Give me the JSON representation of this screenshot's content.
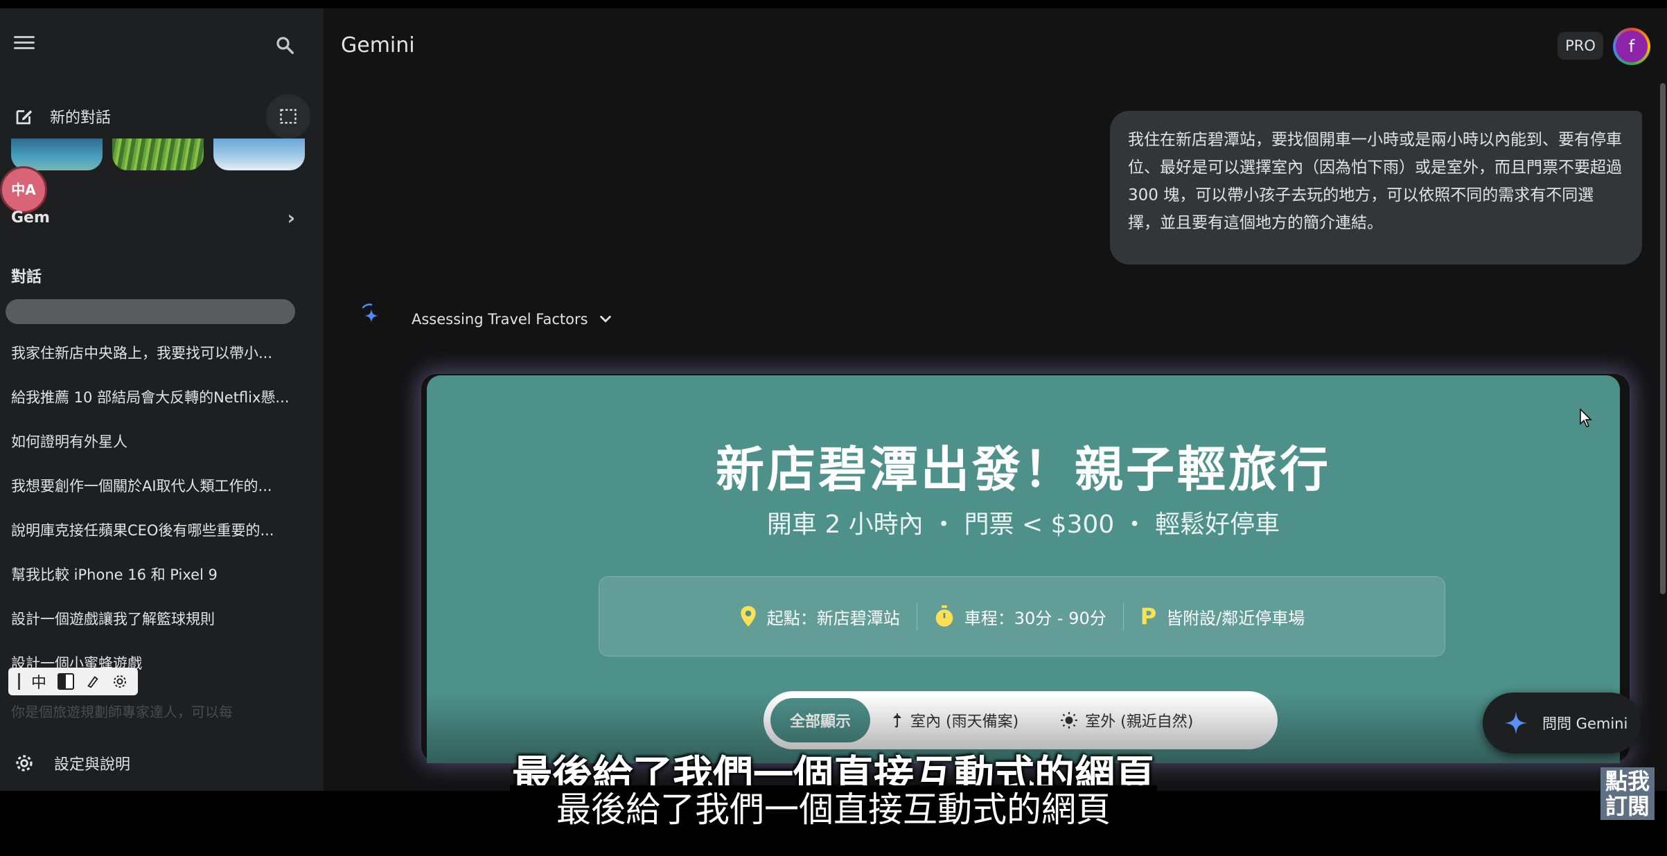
{
  "app": {
    "title": "Gemini",
    "pro_label": "PRO",
    "avatar_letter": "f"
  },
  "sidebar": {
    "new_chat_label": "新的對話",
    "translate_badge": "中A",
    "gem_label": "Gem",
    "conversations_title": "對話",
    "conversations": [
      "我家住新店中央路上，我要找可以帶小...",
      "給我推薦 10 部結局會大反轉的Netflix懸...",
      "如何證明有外星人",
      "我想要創作一個關於AI取代人類工作的...",
      "說明庫克接任蘋果CEO後有哪些重要的...",
      "幫我比較 iPhone 16 和 Pixel 9",
      "設計一個遊戲讓我了解籃球規則",
      "設計一個小蜜蜂遊戲"
    ],
    "faded_item": "你是個旅遊規劃師專家達人，可以每",
    "toolbar_char": "中",
    "settings_label": "設定與說明"
  },
  "chat": {
    "user_message": "我住在新店碧潭站，要找個開車一小時或是兩小時以內能到、要有停車位、最好是可以選擇室內（因為怕下雨）或是室外，而且門票不要超過 300 塊，可以帶小孩子去玩的地方，可以依照不同的需求有不同選擇，並且要有這個地方的簡介連結。",
    "thinking_label": "Assessing Travel Factors"
  },
  "preview": {
    "title": "新店碧潭出發！親子輕旅行",
    "subtitle": "開車 2 小時內 ・ 門票 < $300 ・ 輕鬆好停車",
    "info": [
      {
        "icon": "location-pin-icon",
        "text": "起點：新店碧潭站"
      },
      {
        "icon": "stopwatch-icon",
        "text": "車程：30分 - 90分"
      },
      {
        "icon": "parking-icon",
        "text": "皆附設/鄰近停車場"
      }
    ],
    "parking_symbol": "P",
    "filters": [
      {
        "label": "全部顯示",
        "active": true
      },
      {
        "label": "室內 (雨天備案)",
        "active": false
      },
      {
        "label": "室外 (親近自然)",
        "active": false
      }
    ],
    "accent_color": "#4e908a"
  },
  "ask_gemini_label": "問問 Gemini",
  "overlay": {
    "subtitle_main": "最後給了我們一個直接互動式的網頁",
    "subtitle_sub": "最後給了我們一個直接互動式的網頁",
    "subscribe_line1": "點我",
    "subscribe_line2": "訂閱"
  }
}
